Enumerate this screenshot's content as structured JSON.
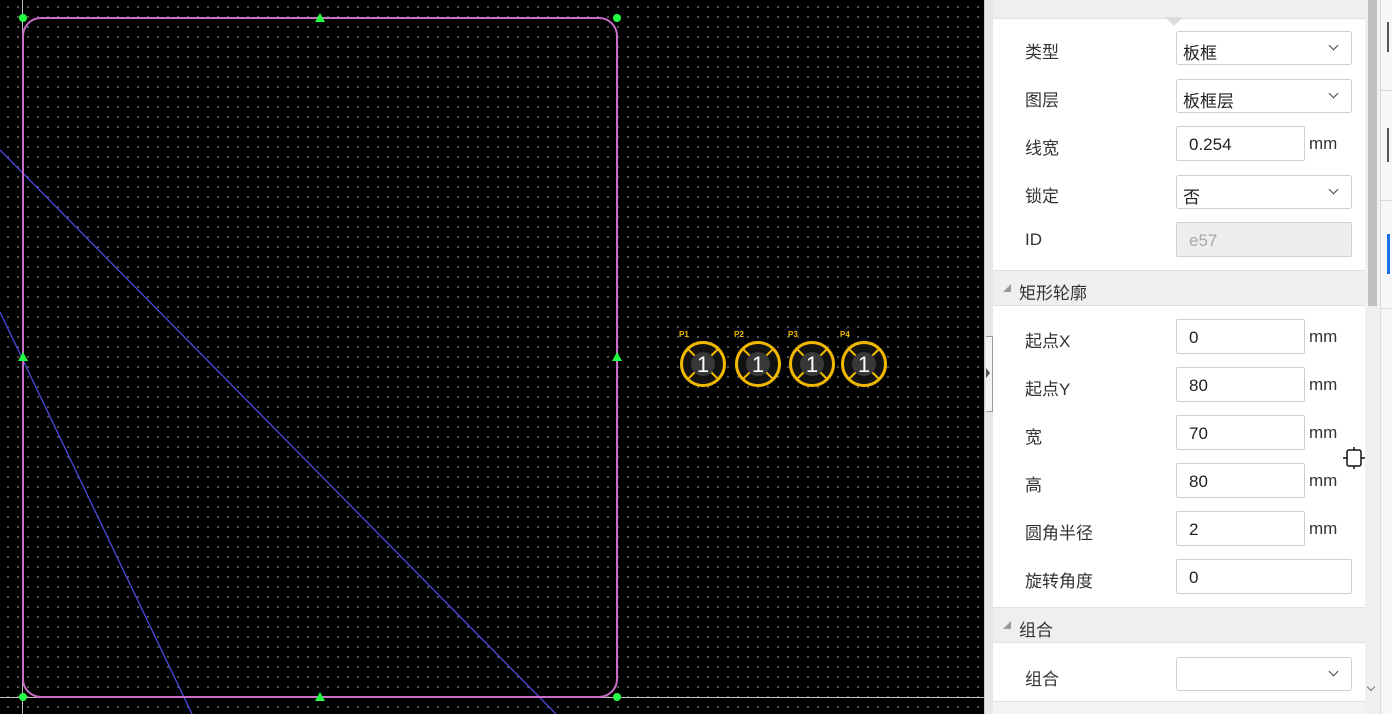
{
  "canvas": {
    "pads": [
      {
        "name": "P1",
        "number": "1"
      },
      {
        "name": "P2",
        "number": "1"
      },
      {
        "name": "P3",
        "number": "1"
      },
      {
        "name": "P4",
        "number": "1"
      }
    ],
    "colors": {
      "background": "#000000",
      "grid_dot": "#6b6b6b",
      "board_outline": "#c86cc8",
      "selection_handle": "#22ff44",
      "ratsnest_line": "#4a4adf",
      "pad": "#f0b800",
      "axis_line": "#bdbdbd"
    }
  },
  "properties": {
    "type": {
      "label": "类型",
      "value": "板框"
    },
    "layer": {
      "label": "图层",
      "value": "板框层"
    },
    "line_width": {
      "label": "线宽",
      "value": "0.254",
      "unit": "mm"
    },
    "lock": {
      "label": "锁定",
      "value": "否"
    },
    "id": {
      "label": "ID",
      "value": "e57"
    }
  },
  "rect_outline": {
    "title": "矩形轮廓",
    "start_x": {
      "label": "起点X",
      "value": "0",
      "unit": "mm"
    },
    "start_y": {
      "label": "起点Y",
      "value": "80",
      "unit": "mm"
    },
    "width": {
      "label": "宽",
      "value": "70",
      "unit": "mm"
    },
    "height": {
      "label": "高",
      "value": "80",
      "unit": "mm"
    },
    "corner_radius": {
      "label": "圆角半径",
      "value": "2",
      "unit": "mm"
    },
    "rotation": {
      "label": "旋转角度",
      "value": "0"
    }
  },
  "group": {
    "title": "组合",
    "field": {
      "label": "组合",
      "value": ""
    }
  }
}
